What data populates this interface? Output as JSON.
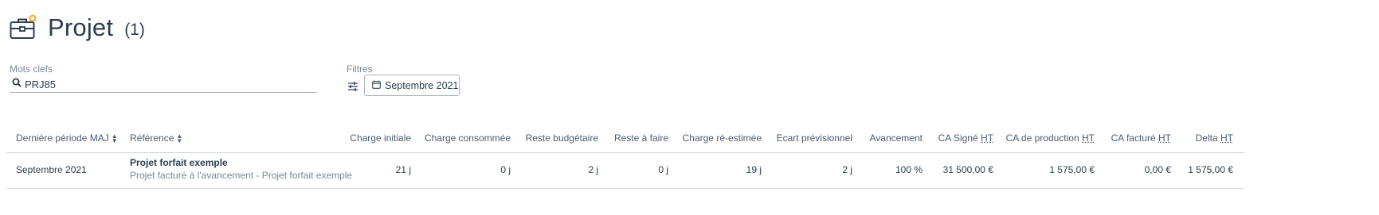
{
  "header": {
    "title": "Projet",
    "count": "(1)",
    "icon": "briefcase-icon"
  },
  "search": {
    "label": "Mots clefs",
    "value": "PRJ85"
  },
  "filters": {
    "label": "Filtres",
    "period_button": "Septembre 2021"
  },
  "table": {
    "columns": {
      "last_period": "Dernière période MAJ",
      "reference": "Référence",
      "initial_charge": "Charge initiale",
      "consumed_charge": "Charge consommée",
      "budget_remaining": "Reste budgétaire",
      "remaining_work": "Reste à faire",
      "re_estimated_charge": "Charge ré-estimée",
      "forecast_gap": "Ecart prévisionnel",
      "progress": "Avancement",
      "ca_signed": "CA Signé",
      "ca_production": "CA de production",
      "ca_invoiced": "CA facturé",
      "delta": "Delta",
      "ht": "HT"
    },
    "rows": [
      {
        "last_period": "Septembre 2021",
        "reference_name": "Projet forfait exemple",
        "reference_sub": "Projet facturé à l'avancement  - Projet forfait exemple",
        "initial_charge": "21 j",
        "consumed_charge": "0 j",
        "budget_remaining": "2 j",
        "remaining_work": "0 j",
        "re_estimated_charge": "19 j",
        "forecast_gap": "2 j",
        "progress": "100 %",
        "ca_signed": "31 500,00 €",
        "ca_production": "1 575,00 €",
        "ca_invoiced": "0,00 €",
        "delta": "1 575,00 €"
      }
    ]
  },
  "colors": {
    "text": "#2c3e50",
    "muted": "#7a8899",
    "border": "#c9d1db",
    "accent": "#f5a623"
  }
}
